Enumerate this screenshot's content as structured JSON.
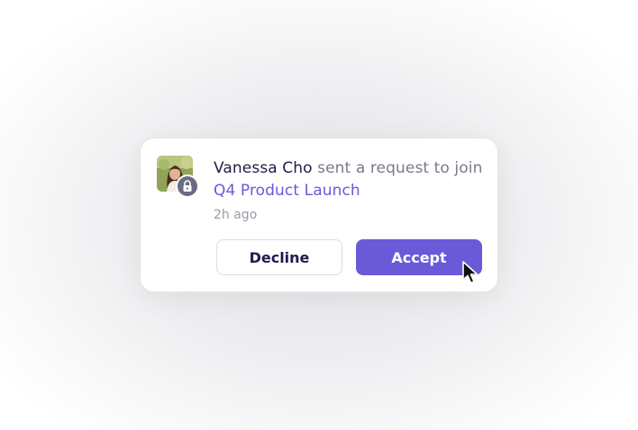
{
  "notification": {
    "sender": "Vanessa Cho",
    "action_text": " sent a request to join ",
    "project": "Q4 Product Launch",
    "time": "2h ago",
    "avatar_icon": "user-photo",
    "badge_icon": "lock-icon"
  },
  "actions": {
    "decline_label": "Decline",
    "accept_label": "Accept"
  },
  "colors": {
    "accent": "#6a5ad8",
    "primary_text": "#1d1d4b",
    "secondary_text": "#7a7a8c",
    "muted_text": "#9a9aa8",
    "badge": "#6b6b82"
  }
}
